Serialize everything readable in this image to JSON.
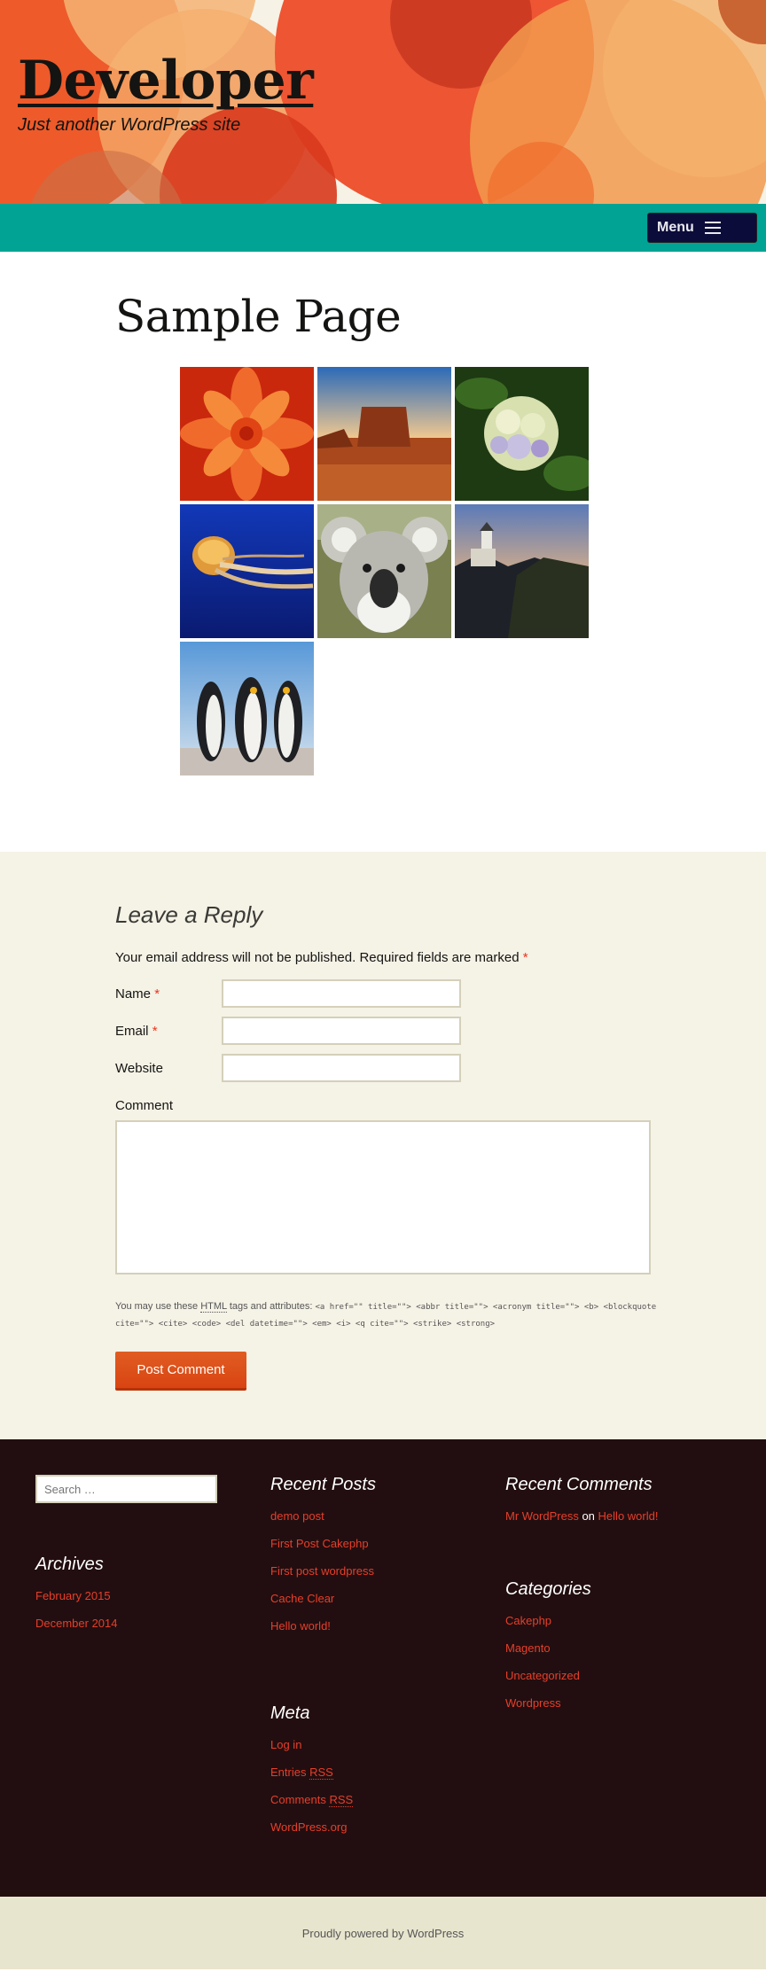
{
  "header": {
    "site_title": "Developer",
    "site_description": "Just another WordPress site"
  },
  "nav": {
    "menu_label": "Menu",
    "menu_icon": "hamburger-icon"
  },
  "page": {
    "title": "Sample Page",
    "gallery": [
      {
        "name": "chrysanthemum",
        "colors": [
          "#f05a1c",
          "#c9280d"
        ]
      },
      {
        "name": "desert",
        "colors": [
          "#c05a2a",
          "#6b2a10"
        ]
      },
      {
        "name": "hydrangeas",
        "colors": [
          "#dfe6c0",
          "#2c4a1a"
        ]
      },
      {
        "name": "jellyfish",
        "colors": [
          "#e09a3a",
          "#12208a"
        ]
      },
      {
        "name": "koala",
        "colors": [
          "#d8d8d0",
          "#6a7050"
        ]
      },
      {
        "name": "lighthouse",
        "colors": [
          "#e6c79a",
          "#2a3040"
        ]
      },
      {
        "name": "penguins",
        "colors": [
          "#a8c8e8",
          "#1e2328"
        ]
      }
    ]
  },
  "comments": {
    "reply_title": "Leave a Reply",
    "notes": "Your email address will not be published. Required fields are marked",
    "required_mark": "*",
    "name_label": "Name",
    "email_label": "Email",
    "website_label": "Website",
    "comment_label": "Comment",
    "name_value": "",
    "email_value": "",
    "website_value": "",
    "comment_value": "",
    "allowed_prefix": "You may use these",
    "allowed_abbr": "HTML",
    "allowed_mid": "tags and attributes:",
    "allowed_code": "<a href=\"\" title=\"\"> <abbr title=\"\"> <acronym title=\"\"> <b> <blockquote cite=\"\"> <cite> <code> <del datetime=\"\"> <em> <i> <q cite=\"\"> <strike> <strong>",
    "submit_label": "Post Comment"
  },
  "footer": {
    "search_placeholder": "Search …",
    "archives_title": "Archives",
    "archives": [
      "February 2015",
      "December 2014"
    ],
    "recent_posts_title": "Recent Posts",
    "recent_posts": [
      "demo post",
      "First Post Cakephp",
      "First post wordpress",
      "Cache Clear",
      "Hello world!"
    ],
    "meta_title": "Meta",
    "meta_login": "Log in",
    "meta_entries": "Entries",
    "meta_comments": "Comments",
    "meta_rss": "RSS",
    "meta_wordpress": "WordPress.org",
    "recent_comments_title": "Recent Comments",
    "recent_comment_author": "Mr WordPress",
    "recent_comment_on": "on",
    "recent_comment_post": "Hello world!",
    "categories_title": "Categories",
    "categories": [
      "Cakephp",
      "Magento",
      "Uncategorized",
      "Wordpress"
    ],
    "powered_by": "Proudly powered by WordPress"
  },
  "colors": {
    "nav_teal": "#00a394",
    "link_red": "#e63f2a",
    "footer_bg": "#220e10",
    "comments_bg": "#f5f2e6",
    "button_orange": "#e05d22"
  }
}
